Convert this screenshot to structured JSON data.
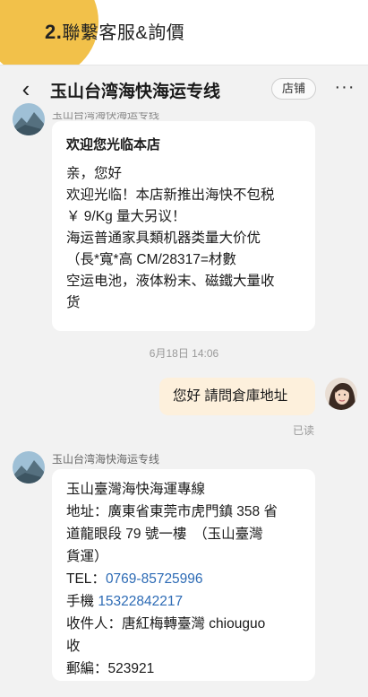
{
  "header": {
    "step_number": "2.",
    "step_title": "聯繫客服&詢價"
  },
  "nav": {
    "title": "玉山台湾海快海运专线",
    "store_label": "店铺",
    "back_glyph": "‹",
    "more_glyph": "···"
  },
  "messages": {
    "first_sender_cropped": "玉山台湾海快海运专线",
    "welcome": {
      "title": "欢迎您光临本店",
      "lines": [
        "亲，您好",
        "欢迎光临！本店新推出海快不包税",
        "￥ 9/Kg 量大另议！",
        "海运普通家具類机器类量大价优",
        "（長*寬*高 CM/28317=材數",
        "空运电池，液体粉末、磁鐵大量收",
        "货"
      ]
    },
    "timestamp": "6月18日 14:06",
    "user_message": "您好 請問倉庫地址",
    "read_status": "已读",
    "reply": {
      "sender": "玉山台湾海快海运专线",
      "lines": [
        "玉山臺灣海快海運專線",
        "地址：廣東省東莞市虎門鎮 358 省",
        "道龍眼段 79 號一樓　（玉山臺灣",
        "貨運）"
      ],
      "tel_label": "TEL：",
      "tel_value": "0769-85725996",
      "mobile_label": "手機 ",
      "mobile_value": "15322842217",
      "tail_lines": [
        "收件人：唐紅梅轉臺灣 chiouguo",
        "收",
        "郵編：523921"
      ]
    }
  },
  "colors": {
    "accent_yellow": "#f2c14a",
    "chat_bg": "#f2f2f2",
    "user_bubble": "#fdf0dc",
    "link_blue": "#2d6bb5"
  },
  "icons": {
    "back": "chevron-left-icon",
    "more": "more-horizontal-icon"
  }
}
